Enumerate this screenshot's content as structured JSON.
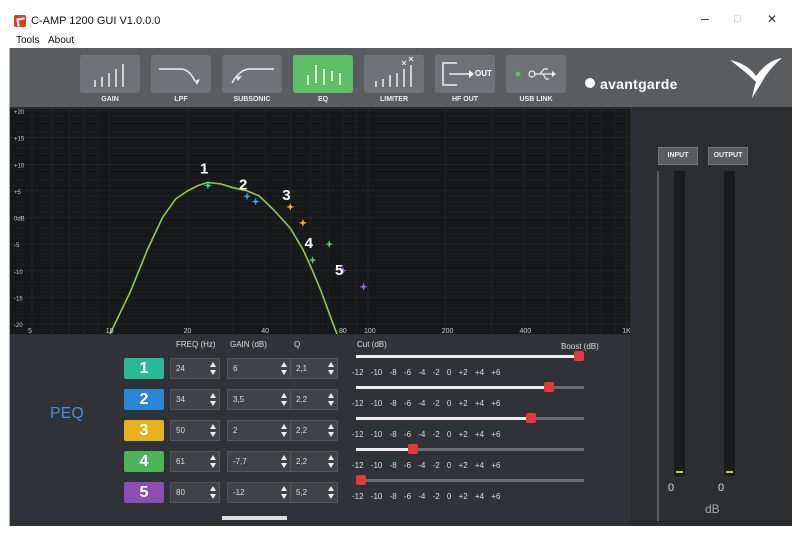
{
  "window": {
    "title": "C-AMP 1200  GUI V1.0.0.0",
    "minimize": "–",
    "maximize": "□",
    "close": "✕"
  },
  "menu": {
    "tools": "Tools",
    "about": "About"
  },
  "toolbar": {
    "items": [
      {
        "label": "GAIN",
        "icon": "gain-bars-icon",
        "active": false
      },
      {
        "label": "LPF",
        "icon": "lowpass-curve-icon",
        "active": false
      },
      {
        "label": "SUBSONIC",
        "icon": "highpass-curve-icon",
        "active": false
      },
      {
        "label": "EQ",
        "icon": "eq-bars-icon",
        "active": true
      },
      {
        "label": "LIMITER",
        "icon": "limiter-bars-icon",
        "active": false
      },
      {
        "label": "HF OUT",
        "icon": "output-arrow-icon",
        "active": false,
        "badge": "OUT"
      },
      {
        "label": "USB LINK",
        "icon": "usb-icon",
        "active": false
      }
    ],
    "brand": "avantgarde",
    "active_color": "#5fbf67"
  },
  "graph": {
    "y_ticks": [
      "+20",
      "+15",
      "+10",
      "+5",
      "0dB",
      "-5",
      "-10",
      "-15",
      "-20"
    ],
    "x_ticks": [
      "5",
      "10",
      "20",
      "40",
      "80",
      "100",
      "200",
      "400",
      "1K"
    ],
    "curve_color": "#8fca4e"
  },
  "peq": {
    "title": "PEQ",
    "headers": {
      "freq": "FREQ (Hz)",
      "gain": "GAIN (dB)",
      "q": "Q",
      "cut": "Cut (dB)",
      "boost": "Boost (dB)"
    },
    "scale": "-12 -10 -8 -6 -4 -2 0 +2 +4 +6",
    "range": [
      -12,
      6
    ],
    "bands": [
      {
        "num": "1",
        "freq": "24",
        "gain": "6",
        "q": "2,1",
        "gain_db": 6,
        "color": "#2bb896",
        "marker_color": "#3ad1b0"
      },
      {
        "num": "2",
        "freq": "34",
        "gain": "3,5",
        "q": "2,2",
        "gain_db": 3.5,
        "color": "#2c84d6",
        "marker_color": "#3a9cf0"
      },
      {
        "num": "3",
        "freq": "50",
        "gain": "2",
        "q": "2,2",
        "gain_db": 2,
        "color": "#e3b21c",
        "marker_color": "#e8b825"
      },
      {
        "num": "4",
        "freq": "61",
        "gain": "-7,7",
        "q": "2,2",
        "gain_db": -7.7,
        "color": "#4cb35a",
        "marker_color": "#4ccc6a"
      },
      {
        "num": "5",
        "freq": "80",
        "gain": "-12",
        "q": "5,2",
        "gain_db": -12,
        "color": "#8a4fb3",
        "marker_color": "#a06ad0"
      }
    ]
  },
  "meters": {
    "input_label": "INPUT",
    "output_label": "OUTPUT",
    "input_value": "0",
    "output_value": "0",
    "unit": "dB"
  }
}
